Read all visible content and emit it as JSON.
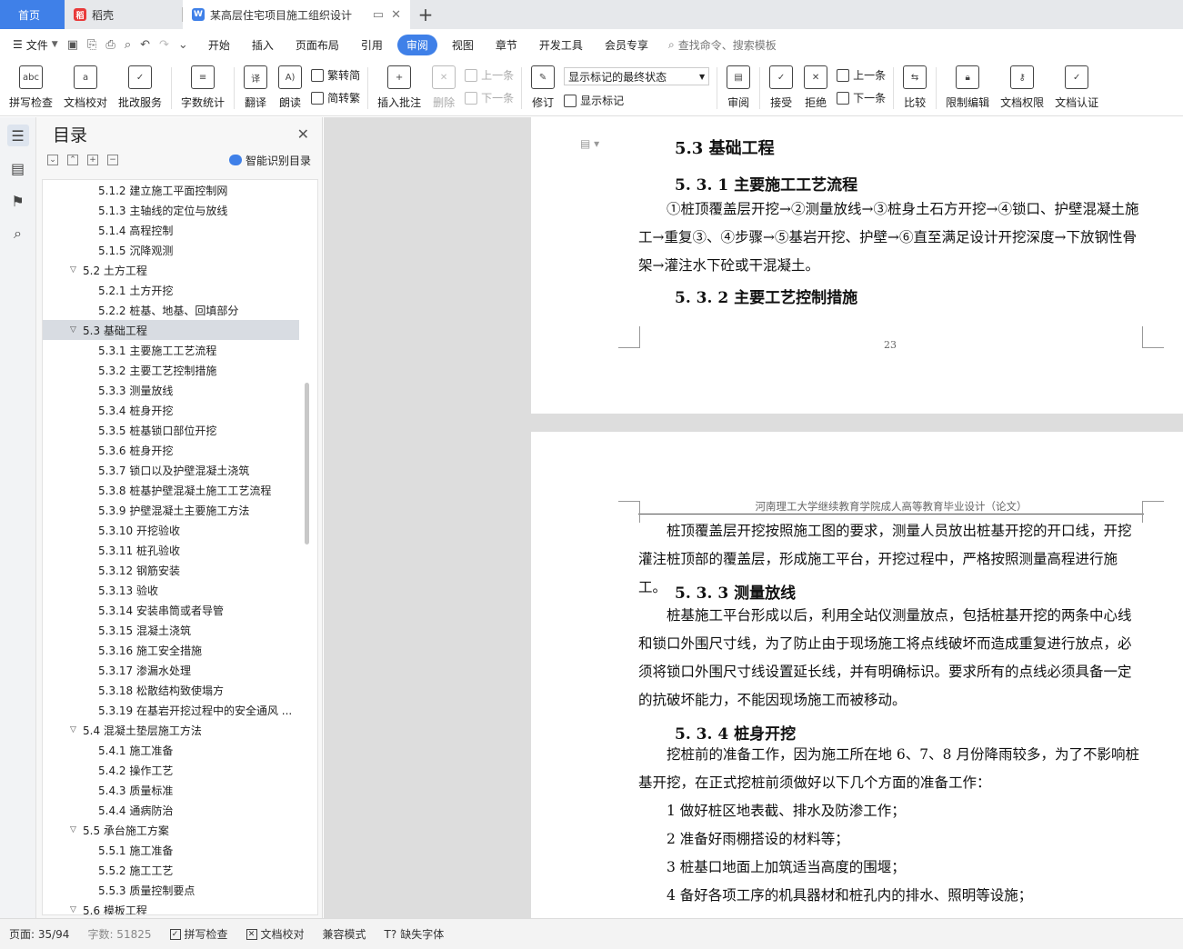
{
  "tabs": {
    "home": "首页",
    "tab1": "稻壳",
    "tab2": "某高层住宅项目施工组织设计"
  },
  "menu": {
    "file": "文件",
    "items": [
      "开始",
      "插入",
      "页面布局",
      "引用",
      "审阅",
      "视图",
      "章节",
      "开发工具",
      "会员专享"
    ],
    "active": "审阅",
    "search": "查找命令、搜索模板"
  },
  "ribbon": {
    "spell": "拼写检查",
    "doccheck": "文档校对",
    "annot_service": "批改服务",
    "wordcount": "字数统计",
    "translate": "翻译",
    "read": "朗读",
    "trad_to_simp": "繁转简",
    "simp_to_trad": "简转繁",
    "insert_comment": "插入批注",
    "delete": "删除",
    "prev": "上一条",
    "next": "下一条",
    "revise": "修订",
    "display_state": "显示标记的最终状态",
    "show_marks": "显示标记",
    "review": "审阅",
    "accept": "接受",
    "reject": "拒绝",
    "prev2": "上一条",
    "next2": "下一条",
    "compare": "比较",
    "restrict": "限制编辑",
    "permission": "文档权限",
    "auth": "文档认证"
  },
  "toc": {
    "title": "目录",
    "smart": "智能识别目录",
    "items": [
      {
        "label": "5.1.2 建立施工平面控制网",
        "level": 3
      },
      {
        "label": "5.1.3 主轴线的定位与放线",
        "level": 3
      },
      {
        "label": "5.1.4  高程控制",
        "level": 3
      },
      {
        "label": "5.1.5 沉降观测",
        "level": 3
      },
      {
        "label": "5.2 土方工程",
        "level": 2
      },
      {
        "label": "5.2.1  土方开挖",
        "level": 3
      },
      {
        "label": "5.2.2  桩基、地基、回填部分",
        "level": 3
      },
      {
        "label": "5.3 基础工程",
        "level": 2,
        "selected": true
      },
      {
        "label": "5.3.1 主要施工工艺流程",
        "level": 3
      },
      {
        "label": "5.3.2  主要工艺控制措施",
        "level": 3
      },
      {
        "label": "5.3.3  测量放线",
        "level": 3
      },
      {
        "label": "5.3.4  桩身开挖",
        "level": 3
      },
      {
        "label": "5.3.5  桩基锁口部位开挖",
        "level": 3
      },
      {
        "label": "5.3.6  桩身开挖",
        "level": 3
      },
      {
        "label": "5.3.7  锁口以及护壁混凝土浇筑",
        "level": 3
      },
      {
        "label": "5.3.8  桩基护壁混凝土施工工艺流程",
        "level": 3
      },
      {
        "label": "5.3.9  护壁混凝土主要施工方法",
        "level": 3
      },
      {
        "label": "5.3.10 开挖验收",
        "level": 3
      },
      {
        "label": "5.3.11 桩孔验收",
        "level": 3
      },
      {
        "label": "5.3.12  钢筋安装",
        "level": 3
      },
      {
        "label": "5.3.13  验收",
        "level": 3
      },
      {
        "label": "5.3.14 安装串筒或者导管",
        "level": 3
      },
      {
        "label": "5.3.15  混凝土浇筑",
        "level": 3
      },
      {
        "label": "5.3.16  施工安全措施",
        "level": 3
      },
      {
        "label": "5.3.17 渗漏水处理",
        "level": 3
      },
      {
        "label": "5.3.18  松散结构致使塌方",
        "level": 3
      },
      {
        "label": "5.3.19 在基岩开挖过程中的安全通风 ...",
        "level": 3
      },
      {
        "label": "5.4 混凝土垫层施工方法",
        "level": 2
      },
      {
        "label": "5.4.1  施工准备",
        "level": 3
      },
      {
        "label": "5.4.2  操作工艺",
        "level": 3
      },
      {
        "label": "5.4.3  质量标准",
        "level": 3
      },
      {
        "label": "5.4.4  通病防治",
        "level": 3
      },
      {
        "label": "5.5  承台施工方案",
        "level": 2
      },
      {
        "label": "5.5.1  施工准备",
        "level": 3
      },
      {
        "label": "5.5.2  施工工艺",
        "level": 3
      },
      {
        "label": "5.5.3  质量控制要点",
        "level": 3
      },
      {
        "label": "5.6  模板工程",
        "level": 2
      }
    ]
  },
  "page1": {
    "h_53": "5.3 基础工程",
    "h_531": "5. 3. 1 主要施工工艺流程",
    "p1": "①桩顶覆盖层开挖→②测量放线→③桩身土石方开挖→④锁口、护壁混凝土施工→重复③、④步骤→⑤基岩开挖、护壁→⑥直至满足设计开挖深度→下放钢性骨架→灌注水下砼或干混凝土。",
    "h_532": "5. 3. 2  主要工艺控制措施",
    "page_number": "23"
  },
  "page2": {
    "header": "河南理工大学继续教育学院成人高等教育毕业设计（论文）",
    "p1": "桩顶覆盖层开挖按照施工图的要求，测量人员放出桩基开挖的开口线，开挖灌注桩顶部的覆盖层，形成施工平台，开挖过程中，严格按照测量高程进行施工。",
    "h_533": "5. 3. 3  测量放线",
    "p2": "桩基施工平台形成以后，利用全站仪测量放点，包括桩基开挖的两条中心线和锁口外围尺寸线，为了防止由于现场施工将点线破坏而造成重复进行放点，必须将锁口外围尺寸线设置延长线，并有明确标识。要求所有的点线必须具备一定的抗破坏能力，不能因现场施工而被移动。",
    "h_534": "5. 3. 4  桩身开挖",
    "p3": "挖桩前的准备工作，因为施工所在地 6、7、8 月份降雨较多，为了不影响桩基开挖，在正式挖桩前须做好以下几个方面的准备工作：",
    "list": [
      "1  做好桩区地表截、排水及防渗工作；",
      "2  准备好雨棚搭设的材料等；",
      "3  桩基口地面上加筑适当高度的围堰；",
      "4  备好各项工序的机具器材和桩孔内的排水、照明等设施；"
    ]
  },
  "status": {
    "page": "页面: 35/94",
    "wordcount": "字数: 51825",
    "spell": "拼写检查",
    "doccheck": "文档校对",
    "compat": "兼容模式",
    "missing_font": "缺失字体"
  }
}
